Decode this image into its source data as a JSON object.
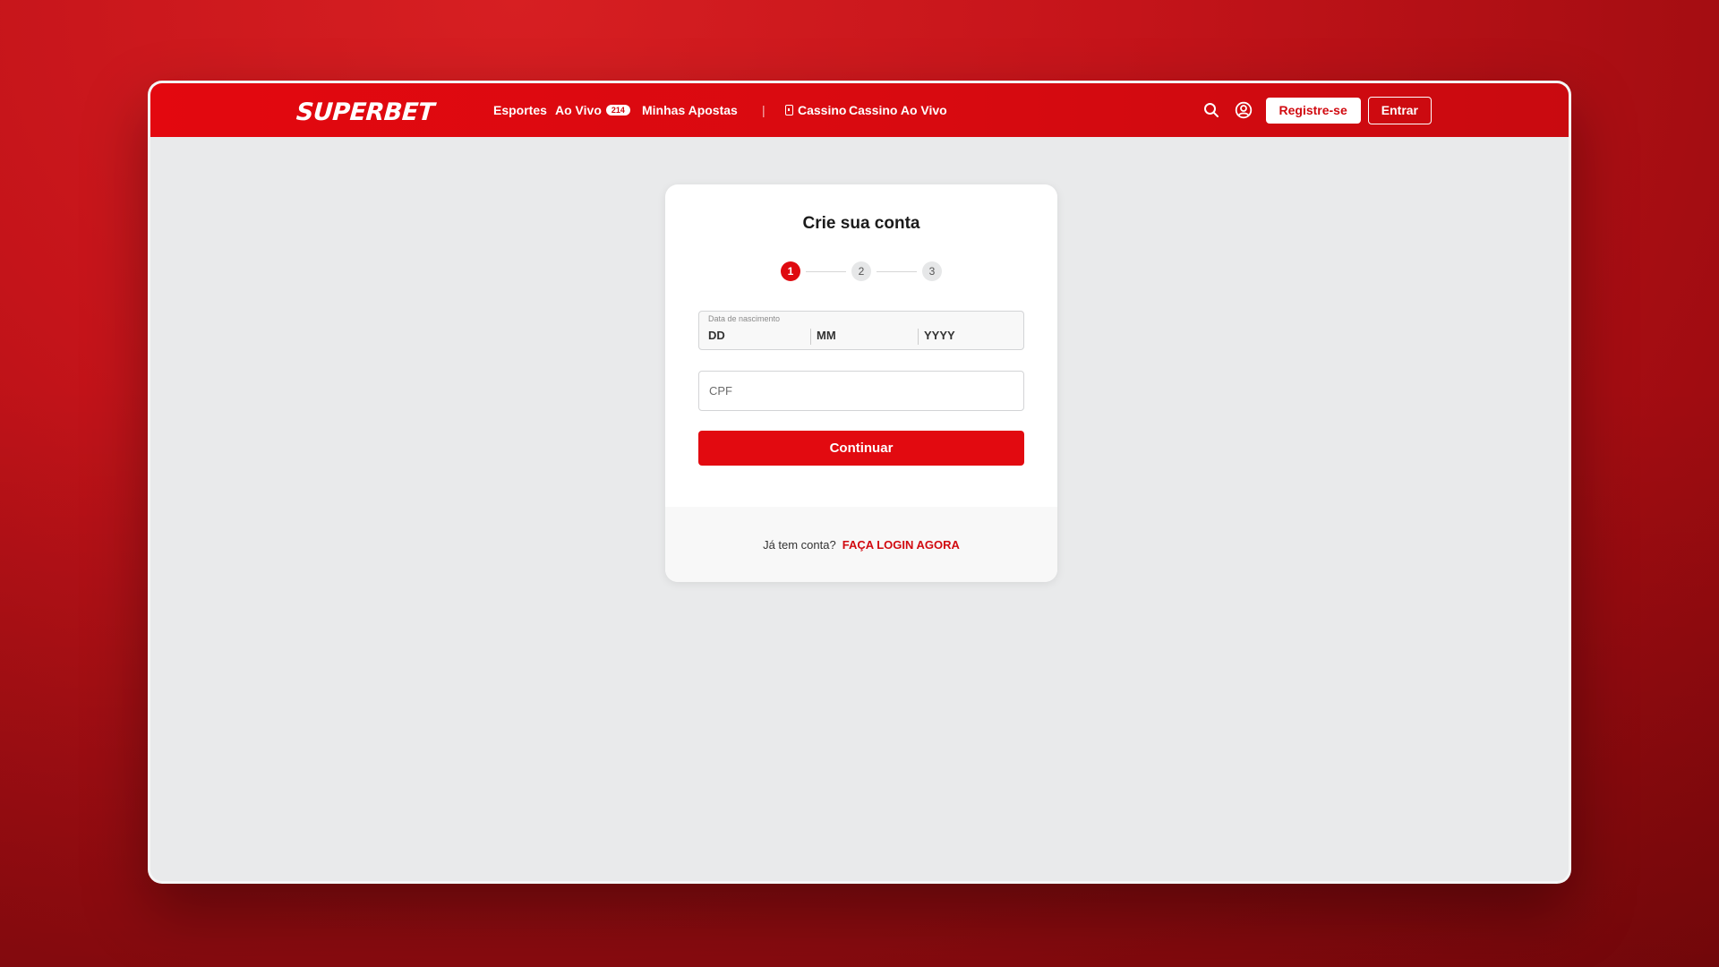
{
  "brand": {
    "logo_text": "SUPERBET",
    "accent": "#e20a10"
  },
  "nav": {
    "items": [
      {
        "label": "Esportes"
      },
      {
        "label": "Ao Vivo",
        "badge": "214"
      },
      {
        "label": "Minhas Apostas"
      }
    ],
    "separator": "|",
    "casino": {
      "label": "Cassino",
      "icon": "card-icon"
    },
    "live_casino": {
      "label": "Cassino Ao Vivo"
    }
  },
  "header_actions": {
    "search_icon": "search-icon",
    "account_icon": "user-circle-icon",
    "register_label": "Registre-se",
    "login_label": "Entrar"
  },
  "form": {
    "title": "Crie sua conta",
    "steps": [
      "1",
      "2",
      "3"
    ],
    "active_step": 1,
    "birthdate": {
      "label": "Data de nascimento",
      "day_placeholder": "DD",
      "month_placeholder": "MM",
      "year_placeholder": "YYYY"
    },
    "cpf": {
      "placeholder": "CPF",
      "value": ""
    },
    "continue_label": "Continuar"
  },
  "footer": {
    "prompt": "Já tem conta?",
    "login_link": "FAÇA LOGIN AGORA"
  }
}
